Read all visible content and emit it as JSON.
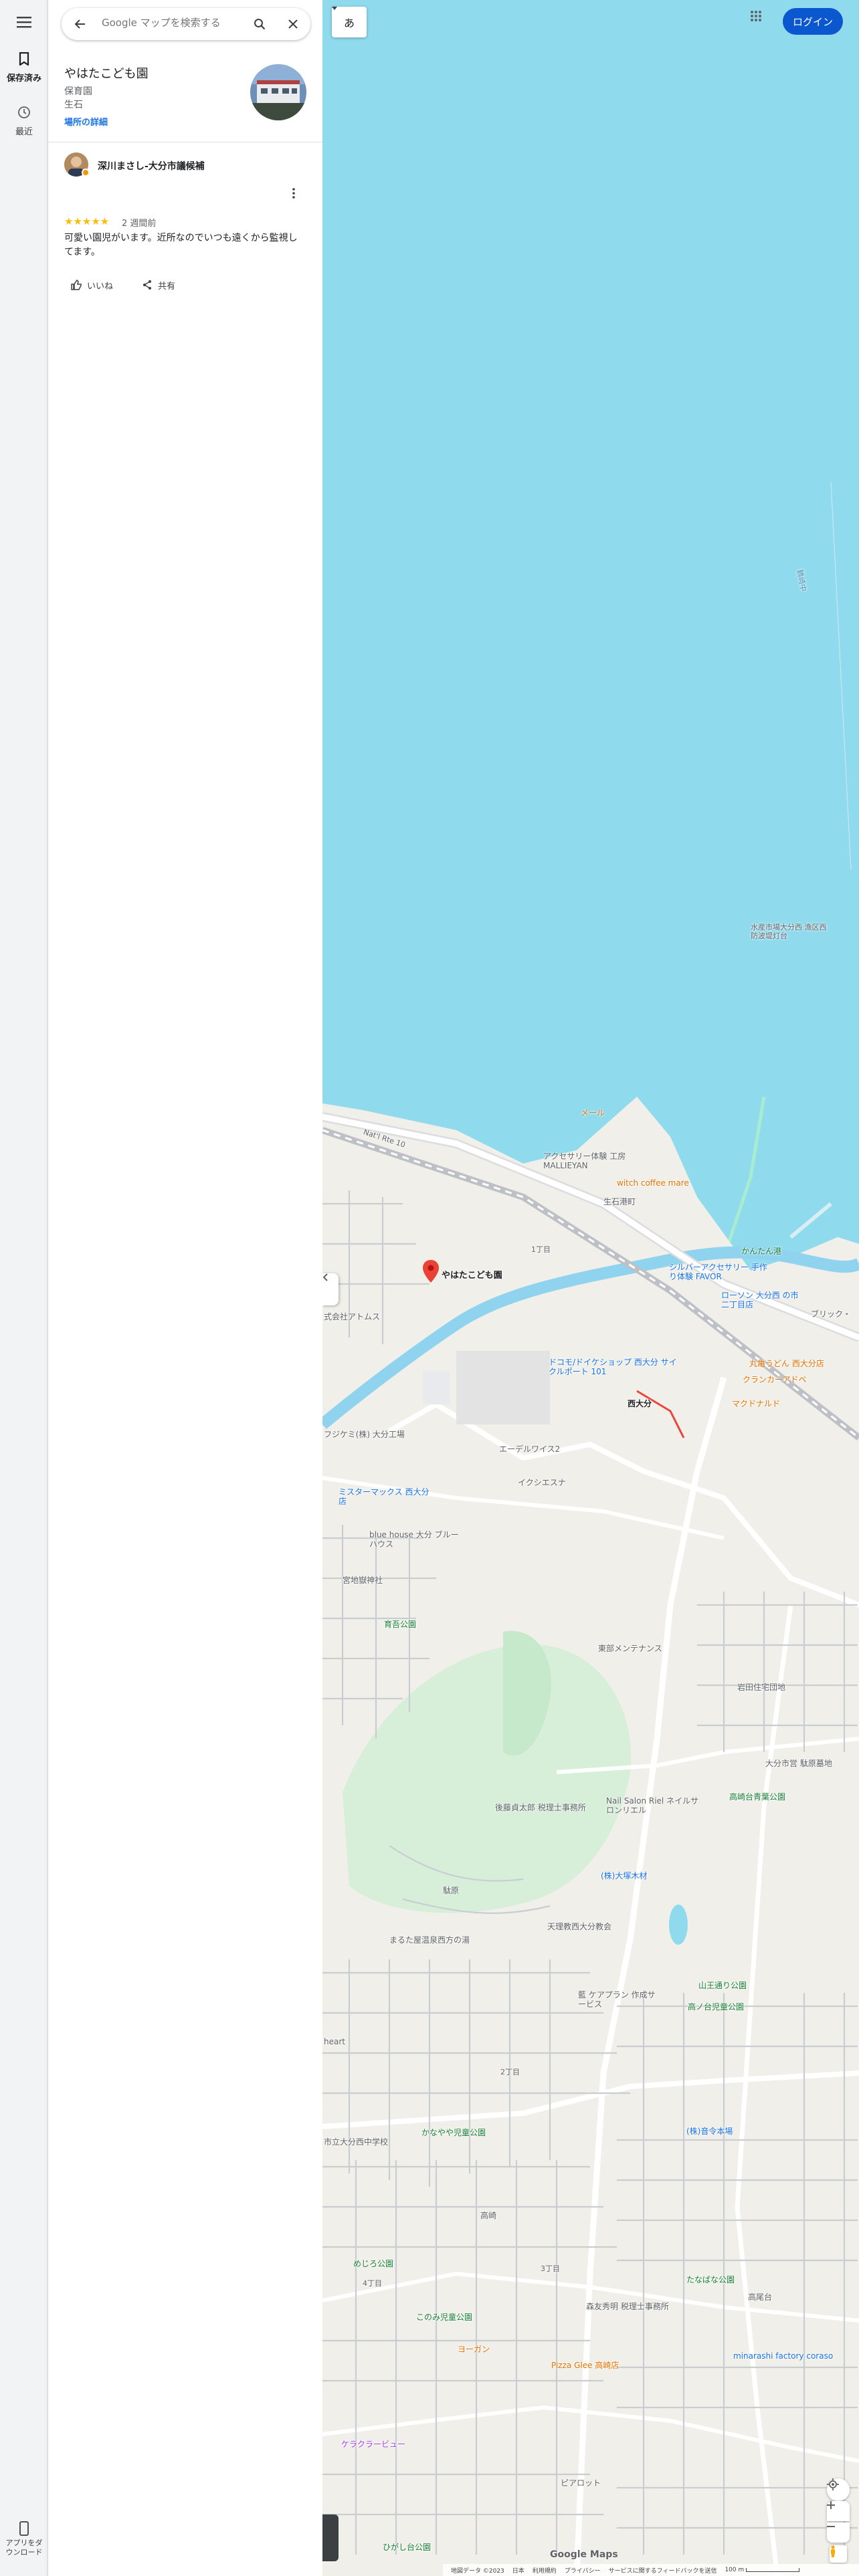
{
  "rail": {
    "saved_label": "保存済み",
    "recent_label": "最近",
    "app_download_label_1": "アプリをダ",
    "app_download_label_2": "ウンロード"
  },
  "search": {
    "placeholder": "Google マップを検索する"
  },
  "place": {
    "name": "やはたこども園",
    "category": "保育園",
    "area": "生石",
    "more_label": "場所の詳細"
  },
  "review": {
    "reviewer": "深川まさし-大分市議候補",
    "stars": "★★★★★",
    "time": "2 週間前",
    "text": "可愛い園児がいます。近所なのでいつも遠くから監視してます。",
    "like_label": "いいね",
    "share_label": "共有"
  },
  "map": {
    "lang_label": "あ",
    "login_label": "ログイン",
    "selected_label": "やはたこども園",
    "labels": {
      "mall": "メール",
      "accessory": "アクセサリー体験 工房 MALLIEYAN",
      "witch": "witch coffee mare",
      "oishi": "生石港町",
      "kantan": "かんたん港",
      "silver": "シルバーアクセサリー 手作り体験 FAVOR",
      "lawson": "ローソン 大分西 の市二丁目店",
      "brick": "ブリック・",
      "atom": "式会社アトムス",
      "docomo": "ドコモ/ドイケショップ 西大分 サイクルポート 101",
      "marugame": "丸亀うどん 西大分店",
      "claw": "クランカーアドベ",
      "mcd": "マクドナルド",
      "nishioita": "西大分",
      "fujikemi": "フジケミ(株) 大分工場",
      "eder": "エーデルワイス2",
      "ixi": "イクシエスナ",
      "mister": "ミスターマックス 西大分店",
      "bluehouse": "blue house 大分 ブルーハウス",
      "miyakogongen": "宮地嶽神社",
      "nagao": "育吾公園",
      "tobu": "東部メンテナンス",
      "iwata": "岩田住宅団地",
      "ooita_house": "大分市営 駄原墓地",
      "nail": "Nail Salon Riel ネイルサロンリエル",
      "goto": "後藤貞太郎 税理士事務所",
      "takasaki": "高崎台青葉公園",
      "oyachi": "(株)大塚木材",
      "dabaru": "駄原",
      "tenri": "天理教西大分教会",
      "marudai": "まるた屋温泉西方の湯",
      "ai": "藍 ケアプラン 作成サービス",
      "yamamotogou": "山王通り公園",
      "takasaki_hill": "高ノ台児童公園",
      "heart": "heart",
      "kanaya": "かなやや児童公園",
      "school": "市立大分西中学校",
      "kabu": "(株)音令本場",
      "takaoka": "高崎",
      "mejiro": "めじろ公園",
      "konomi": "このみ児童公園",
      "yoga": "ヨーガン",
      "pizza": "Pizza Glee 高崎店",
      "tanaka": "たなばな公園",
      "mori": "森友秀明 税理士事務所",
      "takamori": "高尾台",
      "minarashi": "minarashi factory coraso",
      "kerakura": "ケラクラービュー",
      "hirato": "ピアロット",
      "higashi": "ひがし台公園",
      "nat_rte": "Nat'l Rte 10",
      "rd_right": "鶴崎中",
      "ichi_chome": "1丁目",
      "ni_chome": "2丁目",
      "san_chome": "3丁目",
      "yon_chome": "4丁目",
      "oita_nishi_port": "水産市場大分西 漁区西防波堤灯台"
    },
    "google_logo": "Google Maps",
    "footer": {
      "data": "地図データ ©2023",
      "country": "日本",
      "terms": "利用規約",
      "privacy": "プライバシー",
      "feedback": "サービスに関するフィードバックを送信",
      "scale": "100 m"
    }
  }
}
